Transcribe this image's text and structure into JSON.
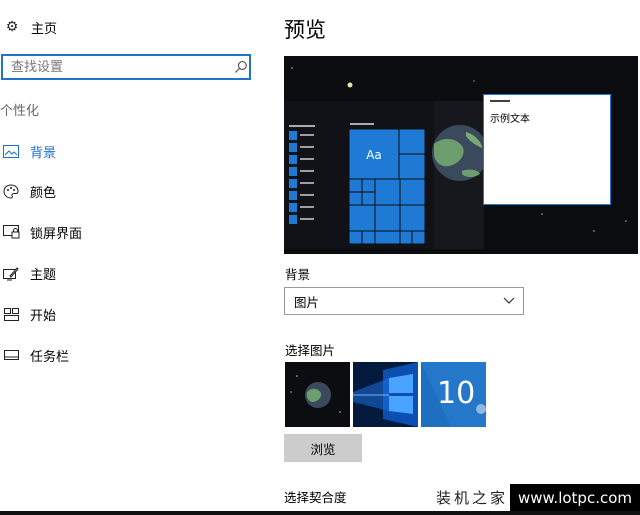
{
  "nav": {
    "home_label": "主页",
    "search_placeholder": "查找设置",
    "section_label": "个性化",
    "items": [
      {
        "label": "背景",
        "icon": "picture-icon"
      },
      {
        "label": "颜色",
        "icon": "palette-icon"
      },
      {
        "label": "锁屏界面",
        "icon": "lock-screen-icon"
      },
      {
        "label": "主题",
        "icon": "theme-icon"
      },
      {
        "label": "开始",
        "icon": "start-icon"
      },
      {
        "label": "任务栏",
        "icon": "taskbar-icon"
      }
    ]
  },
  "main": {
    "title": "预览",
    "preview": {
      "sample_text": "示例文本",
      "tile_label": "Aa"
    },
    "background_label": "背景",
    "background_value": "图片",
    "choose_picture_label": "选择图片",
    "thumbnails": [
      {
        "icon": "earth-wallpaper-thumbnail"
      },
      {
        "icon": "windows-light-wallpaper-thumbnail"
      },
      {
        "icon": "windows-10-wallpaper-thumbnail",
        "text": "10"
      }
    ],
    "browse_label": "浏览",
    "fit_label": "选择契合度"
  },
  "watermark": {
    "cn_text": "装机之家",
    "url_text": "www.lotpc.com"
  },
  "colors": {
    "accent": "#1a6fd2",
    "tile_blue": "#1f7ad6",
    "preview_bg": "#0b0c0f"
  }
}
